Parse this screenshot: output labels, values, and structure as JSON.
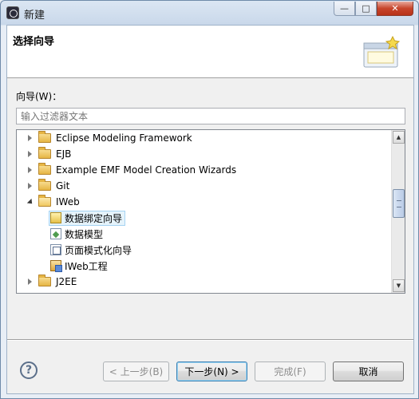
{
  "window": {
    "title": "新建"
  },
  "header": {
    "title": "选择向导"
  },
  "wizard": {
    "label": "向导(W)：",
    "filter_placeholder": "输入过滤器文本"
  },
  "tree": {
    "items": [
      {
        "label": "Eclipse Modeling Framework",
        "type": "folder",
        "expanded": false,
        "level": 0
      },
      {
        "label": "EJB",
        "type": "folder",
        "expanded": false,
        "level": 0
      },
      {
        "label": "Example EMF Model Creation Wizards",
        "type": "folder",
        "expanded": false,
        "level": 0
      },
      {
        "label": "Git",
        "type": "folder",
        "expanded": false,
        "level": 0
      },
      {
        "label": "IWeb",
        "type": "folder",
        "expanded": true,
        "level": 0
      },
      {
        "label": "数据绑定向导",
        "type": "leaf",
        "icon": "binding-wizard-icon",
        "level": 1,
        "selected": true
      },
      {
        "label": "数据模型",
        "type": "leaf",
        "icon": "data-model-icon",
        "level": 1
      },
      {
        "label": "页面模式化向导",
        "type": "leaf",
        "icon": "page-pattern-icon",
        "level": 1
      },
      {
        "label": "IWeb工程",
        "type": "leaf",
        "icon": "iweb-project-icon",
        "level": 1
      },
      {
        "label": "J2EE",
        "type": "folder",
        "expanded": false,
        "level": 0
      }
    ]
  },
  "buttons": {
    "help": "?",
    "back": "< 上一步(B)",
    "next": "下一步(N) >",
    "finish": "完成(F)",
    "cancel": "取消"
  },
  "window_controls": {
    "minimize": "—",
    "maximize": "□",
    "close": "✕"
  }
}
